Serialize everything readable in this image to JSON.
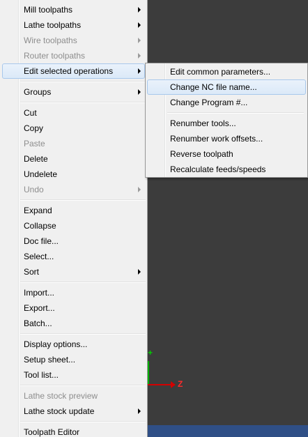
{
  "viewport": {
    "axis_z_label": "Z",
    "axis_y_label": "+"
  },
  "context_menu": {
    "items": [
      {
        "label": "Mill toolpaths",
        "submenu": true,
        "disabled": false
      },
      {
        "label": "Lathe toolpaths",
        "submenu": true,
        "disabled": false
      },
      {
        "label": "Wire toolpaths",
        "submenu": true,
        "disabled": true
      },
      {
        "label": "Router toolpaths",
        "submenu": true,
        "disabled": true
      },
      {
        "label": "Edit selected operations",
        "submenu": true,
        "disabled": false,
        "highlighted": true
      },
      {
        "label": "Groups",
        "submenu": true,
        "disabled": false
      },
      {
        "label": "Cut",
        "disabled": false
      },
      {
        "label": "Copy",
        "disabled": false
      },
      {
        "label": "Paste",
        "disabled": true
      },
      {
        "label": "Delete",
        "disabled": false
      },
      {
        "label": "Undelete",
        "disabled": false
      },
      {
        "label": "Undo",
        "submenu": true,
        "disabled": true
      },
      {
        "label": "Expand",
        "disabled": false
      },
      {
        "label": "Collapse",
        "disabled": false
      },
      {
        "label": "Doc file...",
        "disabled": false
      },
      {
        "label": "Select...",
        "disabled": false
      },
      {
        "label": "Sort",
        "submenu": true,
        "disabled": false
      },
      {
        "label": "Import...",
        "disabled": false
      },
      {
        "label": "Export...",
        "disabled": false
      },
      {
        "label": "Batch...",
        "disabled": false
      },
      {
        "label": "Display options...",
        "disabled": false
      },
      {
        "label": "Setup sheet...",
        "disabled": false
      },
      {
        "label": "Tool list...",
        "disabled": false
      },
      {
        "label": "Lathe stock preview",
        "disabled": true
      },
      {
        "label": "Lathe stock update",
        "submenu": true,
        "disabled": false
      },
      {
        "label": "Toolpath Editor",
        "disabled": false
      }
    ]
  },
  "submenu": {
    "items": [
      {
        "label": "Edit common parameters..."
      },
      {
        "label": "Change NC file name...",
        "highlighted": true
      },
      {
        "label": "Change Program #..."
      },
      {
        "label": "Renumber tools..."
      },
      {
        "label": "Renumber work offsets..."
      },
      {
        "label": "Reverse toolpath"
      },
      {
        "label": "Recalculate feeds/speeds"
      }
    ]
  }
}
